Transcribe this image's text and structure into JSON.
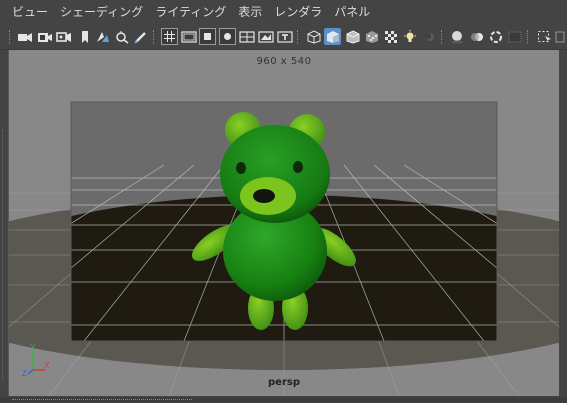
{
  "menubar": {
    "items": [
      "ビュー",
      "シェーディング",
      "ライティング",
      "表示",
      "レンダラ",
      "パネル"
    ]
  },
  "toolbar": {
    "icons": [
      "select-camera-icon",
      "camera-attributes-icon",
      "bookmark-icon",
      "image-plane-icon",
      "2d-pan-zoom-icon",
      "grease-pencil-icon",
      "grid-icon",
      "film-gate-icon",
      "resolution-gate-icon",
      "gate-mask-icon",
      "field-chart-icon",
      "safe-action-icon",
      "safe-title-icon",
      "wireframe-icon",
      "smooth-shade-icon",
      "wireframe-on-shaded-icon",
      "textured-icon",
      "use-all-lights-icon",
      "shadows-icon",
      "screen-space-ao-icon",
      "motion-blur-icon",
      "multisample-aa-icon",
      "depth-of-field-icon",
      "isolate-select-icon",
      "xray-icon"
    ]
  },
  "viewport": {
    "resolution_label": "960 x 540",
    "camera_label": "persp",
    "axis": {
      "y": "Y",
      "x": "X",
      "z": "Z"
    },
    "colors": {
      "background": "#888888",
      "ground": "#1e1a10",
      "bear_body": "#1f8a1a",
      "bear_highlight": "#6ab81e",
      "grid": "#bdbdbd"
    }
  }
}
